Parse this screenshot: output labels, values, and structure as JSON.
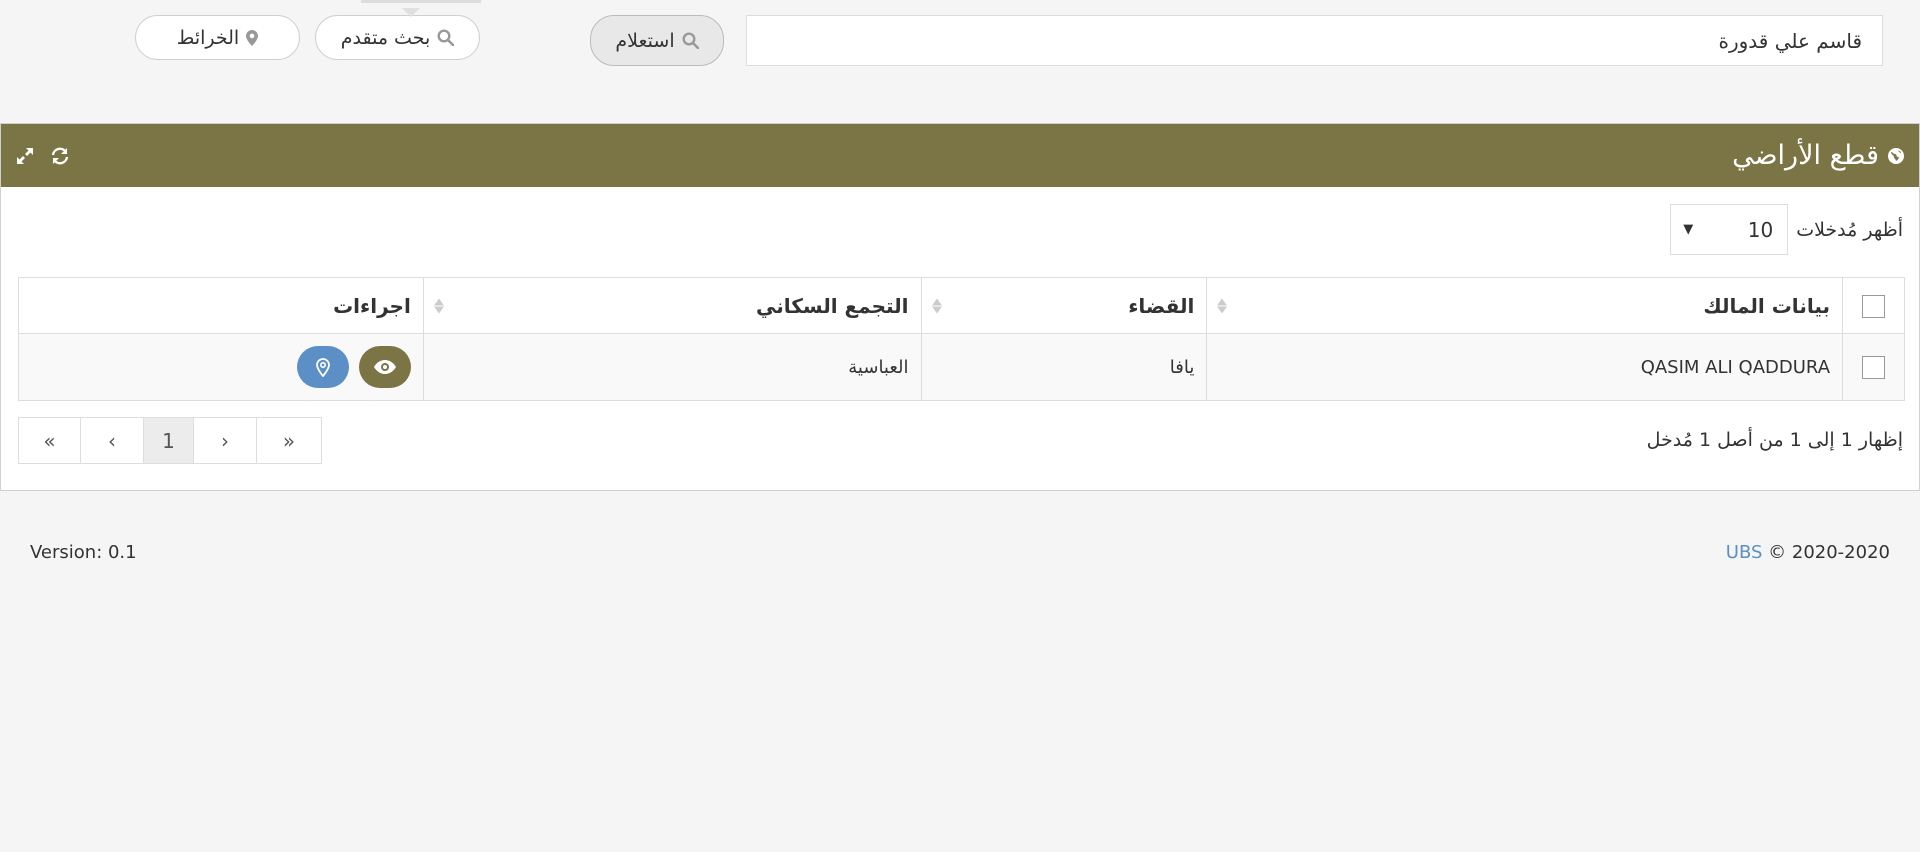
{
  "toolbar": {
    "search_value": "قاسم علي قدورة",
    "query_label": "استعلام",
    "advanced_label": "بحث متقدم",
    "maps_label": "الخرائط"
  },
  "panel": {
    "title": "قطع الأراضي",
    "length_label": "أظهر مُدخلات",
    "length_value": "10"
  },
  "table": {
    "headers": [
      "بيانات المالك",
      "القضاء",
      "التجمع السكاني",
      "اجراءات"
    ],
    "rows": [
      [
        "QASIM ALI QADDURA",
        "يافا",
        "العباسية"
      ]
    ]
  },
  "info_text": "إظهار 1 إلى 1 من أصل 1 مُدخل",
  "pagination": {
    "first": "«",
    "prev": "‹",
    "current": "1",
    "next": "›",
    "last": "»"
  },
  "footer": {
    "version": "Version: 0.1",
    "brand": "UBS",
    "copyright": "© 2020-2020"
  },
  "colors": {
    "accent": "#7b7545",
    "link": "#5b8fc5",
    "background": "#f5f5f5"
  }
}
